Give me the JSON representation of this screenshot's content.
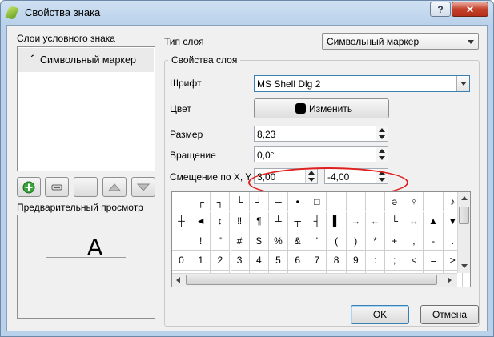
{
  "window": {
    "title": "Свойства знака",
    "help_label": "?",
    "close_label": "✕"
  },
  "left": {
    "layers_heading": "Слои условного знака",
    "layers": [
      {
        "label": "Символьный маркер",
        "mark": "ˊ"
      }
    ],
    "buttons": [
      {
        "name": "add-layer-button",
        "icon": "plus-icon"
      },
      {
        "name": "remove-layer-button",
        "icon": "minus-icon"
      },
      {
        "name": "lock-layer-button",
        "icon": "blank-icon"
      },
      {
        "name": "move-up-button",
        "icon": "triangle-up-icon"
      },
      {
        "name": "move-down-button",
        "icon": "triangle-down-icon"
      }
    ],
    "preview_heading": "Предварительный просмотр",
    "preview_char": "A"
  },
  "right": {
    "layer_type_label": "Тип слоя",
    "layer_type_value": "Символьный маркер",
    "group_title": "Свойства слоя",
    "font_label": "Шрифт",
    "font_value": "MS Shell Dlg 2",
    "color_label": "Цвет",
    "color_button_label": "Изменить",
    "color_value": "#000000",
    "size_label": "Размер",
    "size_value": "8,23",
    "rotation_label": "Вращение",
    "rotation_value": "0,0°",
    "offset_label": "Смещение по X, Y",
    "offset_x": "3,00",
    "offset_y": "-4,00"
  },
  "charmap": {
    "rows": [
      [
        "",
        "┌",
        "┐",
        "└",
        "┘",
        "─",
        "•",
        "□",
        "",
        "",
        "",
        "ə",
        "♀",
        "",
        "♪"
      ],
      [
        "┼",
        "◄",
        "↕",
        "‼",
        "¶",
        "┴",
        "┬",
        "┤",
        "▌",
        "→",
        "←",
        "└",
        "↔",
        "▲",
        "▼"
      ],
      [
        "",
        "!",
        "\"",
        "#",
        "$",
        "%",
        "&",
        "'",
        "(",
        ")",
        "*",
        "+",
        ",",
        "-",
        "."
      ],
      [
        "0",
        "1",
        "2",
        "3",
        "4",
        "5",
        "6",
        "7",
        "8",
        "9",
        ":",
        ";",
        "<",
        "=",
        ">"
      ],
      [
        "",
        "",
        "",
        "",
        "",
        "",
        "",
        "",
        "",
        "",
        "",
        "",
        "",
        "",
        ""
      ]
    ]
  },
  "footer": {
    "ok_label": "OK",
    "cancel_label": "Отмена"
  },
  "highlight_color": "#e02020"
}
